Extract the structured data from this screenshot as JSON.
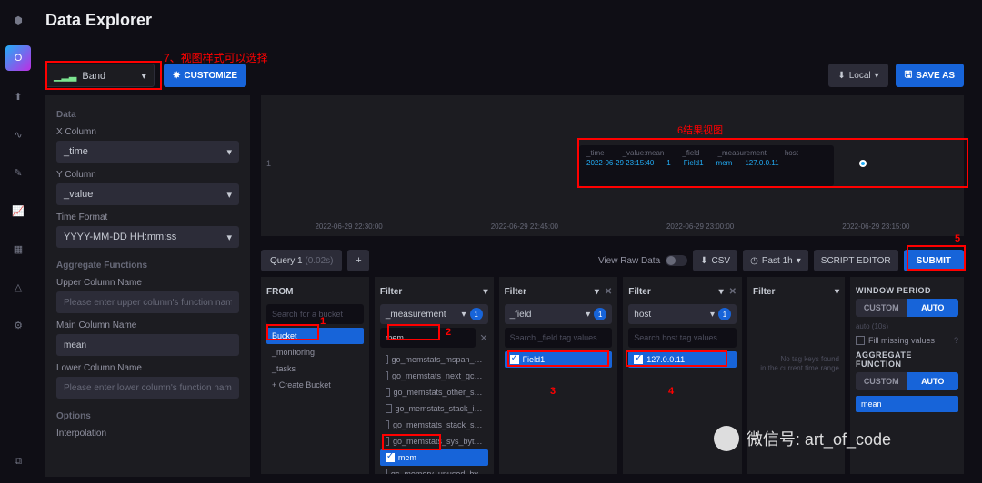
{
  "header": {
    "title": "Data Explorer"
  },
  "anno": {
    "view": "7、视图样式可以选择",
    "result": "6结果视图"
  },
  "view": {
    "selected": "Band",
    "customize": "CUSTOMIZE",
    "local": "Local",
    "saveas": "SAVE AS"
  },
  "left": {
    "data": "Data",
    "xcol_label": "X Column",
    "xcol": "_time",
    "ycol_label": "Y Column",
    "ycol": "_value",
    "tf_label": "Time Format",
    "tf": "YYYY-MM-DD HH:mm:ss",
    "agg": "Aggregate Functions",
    "upper_label": "Upper Column Name",
    "upper_ph": "Please enter upper column's function name",
    "main_label": "Main Column Name",
    "main": "mean",
    "lower_label": "Lower Column Name",
    "lower_ph": "Please enter lower column's function name",
    "options": "Options",
    "interp": "Interpolation"
  },
  "chart_data": {
    "type": "line",
    "x_ticks": [
      "2022-06-29 22:30:00",
      "2022-06-29 22:45:00",
      "2022-06-29 23:00:00",
      "2022-06-29 23:15:00"
    ],
    "y_ticks": [
      "1"
    ],
    "tooltip": {
      "headers": [
        "_time",
        "_value:mean",
        "_field",
        "_measurement",
        "host"
      ],
      "values": [
        "2022-06-29 23:15:40",
        "1",
        "Field1",
        "mem",
        "127.0.0.11"
      ]
    }
  },
  "query": {
    "tab": "Query 1",
    "time": "(0.02s)",
    "raw": "View Raw Data",
    "csv": "CSV",
    "past": "Past 1h",
    "editor": "SCRIPT EDITOR",
    "submit": "SUBMIT"
  },
  "from": {
    "title": "FROM",
    "search_ph": "Search for a bucket",
    "items": [
      "Bucket",
      "_monitoring",
      "_tasks",
      "+ Create Bucket"
    ],
    "selected": "Bucket"
  },
  "filter1": {
    "title": "Filter",
    "key": "_measurement",
    "search": "mem",
    "count": "1",
    "items": [
      "go_memstats_mspan_…",
      "go_memstats_next_gc…",
      "go_memstats_other_s…",
      "go_memstats_stack_i…",
      "go_memstats_stack_s…",
      "go_memstats_sys_byt…",
      "mem",
      "qc_memory_unused_by…"
    ],
    "selected": "mem"
  },
  "filter2": {
    "title": "Filter",
    "key": "_field",
    "search_ph": "Search _field tag values",
    "count": "1",
    "items": [
      "Field1"
    ],
    "selected": "Field1"
  },
  "filter3": {
    "title": "Filter",
    "key": "host",
    "search_ph": "Search host tag values",
    "count": "1",
    "items": [
      "127.0.0.11"
    ],
    "selected": "127.0.0.11"
  },
  "filter4": {
    "title": "Filter",
    "notag1": "No tag keys found",
    "notag2": "in the current time range"
  },
  "right": {
    "wp": "WINDOW PERIOD",
    "custom": "CUSTOM",
    "auto": "AUTO",
    "auto_hint": "auto (10s)",
    "fill": "Fill missing values",
    "af": "AGGREGATE FUNCTION",
    "mean": "mean"
  },
  "wechat": "微信号: art_of_code"
}
